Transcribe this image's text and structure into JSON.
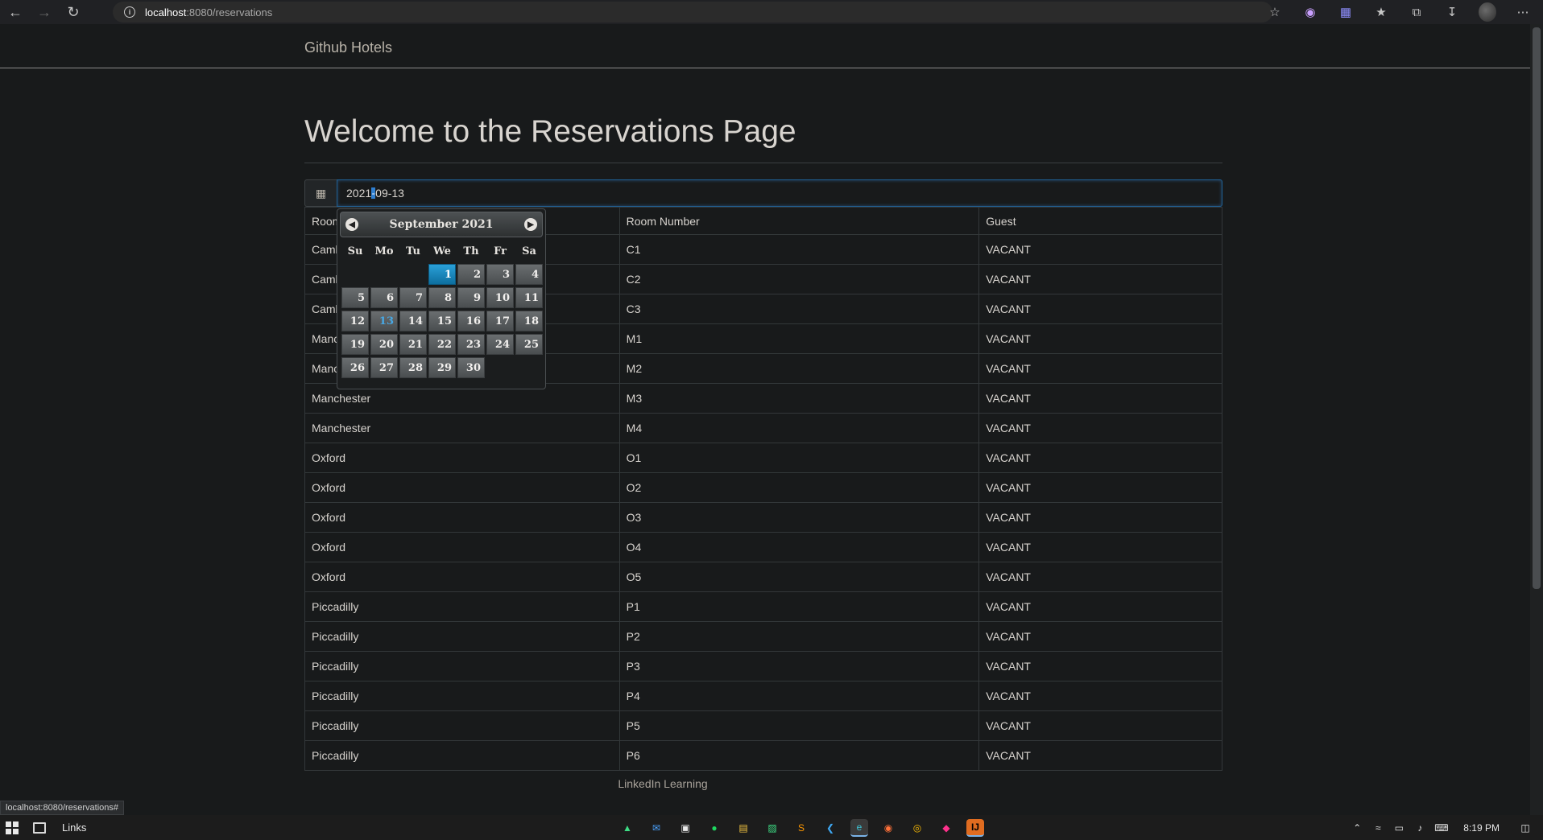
{
  "browser": {
    "url_host": "localhost",
    "url_rest": ":8080/reservations",
    "icons": [
      "back-icon",
      "forward-icon",
      "refresh-icon",
      "info-icon",
      "add-favorite-icon",
      "extension-icon",
      "extension-icon-2",
      "favorites-icon",
      "collections-icon",
      "downloads-icon",
      "profile-avatar",
      "more-icon"
    ]
  },
  "navbar": {
    "brand": "Github Hotels"
  },
  "page": {
    "title": "Welcome to the Reservations Page"
  },
  "date_picker": {
    "value_before": "2021",
    "value_after": "09-13",
    "month_label": "September 2021",
    "prev_icon": "chevron-left-icon",
    "next_icon": "chevron-right-icon",
    "days_of_week": [
      "Su",
      "Mo",
      "Tu",
      "We",
      "Th",
      "Fr",
      "Sa"
    ],
    "weeks": [
      [
        "",
        "",
        "",
        "1",
        "2",
        "3",
        "4"
      ],
      [
        "5",
        "6",
        "7",
        "8",
        "9",
        "10",
        "11"
      ],
      [
        "12",
        "13",
        "14",
        "15",
        "16",
        "17",
        "18"
      ],
      [
        "19",
        "20",
        "21",
        "22",
        "23",
        "24",
        "25"
      ],
      [
        "26",
        "27",
        "28",
        "29",
        "30",
        "",
        ""
      ]
    ],
    "active_day": "1",
    "today": "13"
  },
  "table": {
    "headers": [
      "Room Name",
      "Room Number",
      "Guest"
    ],
    "rows": [
      [
        "Cambridge",
        "C1",
        "VACANT"
      ],
      [
        "Cambridge",
        "C2",
        "VACANT"
      ],
      [
        "Cambridge",
        "C3",
        "VACANT"
      ],
      [
        "Manchester",
        "M1",
        "VACANT"
      ],
      [
        "Manchester",
        "M2",
        "VACANT"
      ],
      [
        "Manchester",
        "M3",
        "VACANT"
      ],
      [
        "Manchester",
        "M4",
        "VACANT"
      ],
      [
        "Oxford",
        "O1",
        "VACANT"
      ],
      [
        "Oxford",
        "O2",
        "VACANT"
      ],
      [
        "Oxford",
        "O3",
        "VACANT"
      ],
      [
        "Oxford",
        "O4",
        "VACANT"
      ],
      [
        "Oxford",
        "O5",
        "VACANT"
      ],
      [
        "Piccadilly",
        "P1",
        "VACANT"
      ],
      [
        "Piccadilly",
        "P2",
        "VACANT"
      ],
      [
        "Piccadilly",
        "P3",
        "VACANT"
      ],
      [
        "Piccadilly",
        "P4",
        "VACANT"
      ],
      [
        "Piccadilly",
        "P5",
        "VACANT"
      ],
      [
        "Piccadilly",
        "P6",
        "VACANT"
      ]
    ]
  },
  "footer": {
    "text": "LinkedIn Learning"
  },
  "status_bar": {
    "url": "localhost:8080/reservations#"
  },
  "taskbar": {
    "search_label": "Links",
    "apps": [
      "android-studio-icon",
      "mail-icon",
      "store-icon",
      "spotify-icon",
      "file-explorer-icon",
      "terminal-icon",
      "sublime-icon",
      "vscode-icon",
      "edge-icon",
      "firefox-icon",
      "chrome-icon",
      "jetbrains-toolbox-icon",
      "intellij-icon"
    ],
    "clock": "8:19 PM"
  },
  "colors": {
    "page_bg": "#181a1b",
    "accent_blue": "#1f5f93",
    "active_day": "#0d6f9f"
  }
}
